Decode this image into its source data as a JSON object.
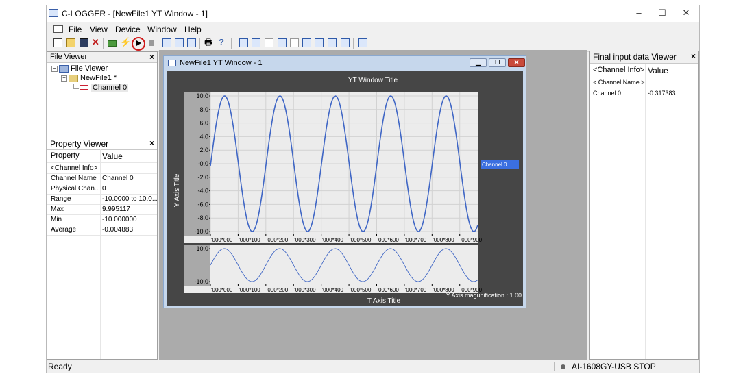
{
  "window": {
    "title": "C-LOGGER - [NewFile1 YT Window - 1]",
    "minimize": "–",
    "maximize": "☐",
    "close": "✕"
  },
  "menu": [
    "File",
    "View",
    "Device",
    "Window",
    "Help"
  ],
  "toolbar": {
    "highlighted": "run-button",
    "highlight_color": "#d01a1a"
  },
  "file_viewer": {
    "title": "File Viewer",
    "close": "×",
    "root": "File Viewer",
    "file": "NewFile1 *",
    "channel": "Channel 0"
  },
  "property_viewer": {
    "title": "Property Viewer",
    "close": "×",
    "col_property": "Property",
    "col_value": "Value",
    "rows": [
      {
        "label": "<Channel Info>",
        "value": ""
      },
      {
        "label": "Channel Name",
        "value": "Channel 0"
      },
      {
        "label": "Physical Chan...",
        "value": "0"
      },
      {
        "label": "Range",
        "value": "-10.0000 to 10.0..."
      },
      {
        "label": "Max",
        "value": "9.995117"
      },
      {
        "label": "Min",
        "value": "-10.000000"
      },
      {
        "label": "Average",
        "value": "-0.004883"
      }
    ]
  },
  "final_viewer": {
    "title": "Final input data Viewer",
    "close": "×",
    "col_info": "<Channel Info>",
    "col_value": "Value",
    "subheader": "< Channel Name >",
    "rows": [
      {
        "label": "Channel 0",
        "value": "-0.317383"
      }
    ]
  },
  "yt_window": {
    "title": "NewFile1 YT Window - 1",
    "btn_min": "▁",
    "btn_restore": "❐",
    "btn_close": "✕"
  },
  "chart_data": [
    {
      "type": "line",
      "title": "YT Window Title",
      "ylabel": "Y Axis Title",
      "xlabel": "",
      "ylim": [
        -10,
        10
      ],
      "yticks": [
        "10.0",
        "8.0",
        "6.0",
        "4.0",
        "2.0",
        "-0.0",
        "-2.0",
        "-4.0",
        "-6.0",
        "-8.0",
        "-10.0"
      ],
      "xticks": [
        "'000*000",
        "'000*100",
        "'000*200",
        "'000*300",
        "'000*400",
        "'000*500",
        "'000*600",
        "'000*700",
        "'000*800",
        "'000*900"
      ],
      "grid": true,
      "series": [
        {
          "name": "Channel 0",
          "color": "#3f66c5",
          "shape": "sine",
          "amplitude": 10,
          "period": 200,
          "phase_start_value": -0.3
        }
      ],
      "legend": "right"
    },
    {
      "type": "line",
      "title": "",
      "xlabel": "T Axis Title",
      "ylabel": "",
      "ylim": [
        -10,
        10
      ],
      "yticks": [
        "10.0",
        "-10.0"
      ],
      "xticks": [
        "'000*000",
        "'000*100",
        "'000*200",
        "'000*300",
        "'000*400",
        "'000*500",
        "'000*600",
        "'000*700",
        "'000*800",
        "'000*900"
      ],
      "annotation": "Y Axis magunification : 1.00",
      "series": [
        {
          "color": "#3f66c5",
          "shape": "sine",
          "amplitude": 10,
          "period": 200
        }
      ]
    }
  ],
  "status": {
    "left": "Ready",
    "right": "AI-1608GY-USB STOP"
  }
}
